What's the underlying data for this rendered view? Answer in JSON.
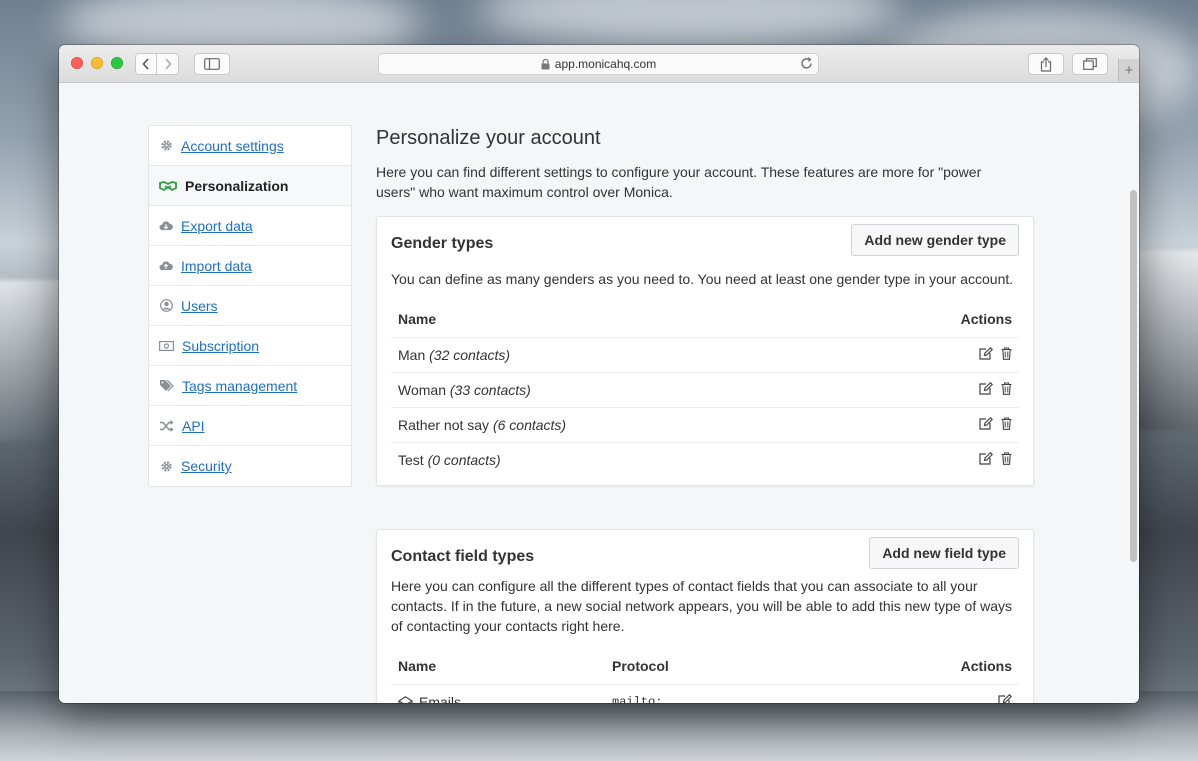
{
  "browser": {
    "url": "app.monicahq.com"
  },
  "sidebar": {
    "items": [
      {
        "label": "Account settings",
        "icon": "gear-icon",
        "active": false
      },
      {
        "label": "Personalization",
        "icon": "handshake-icon",
        "active": true
      },
      {
        "label": "Export data",
        "icon": "cloud-download-icon",
        "active": false
      },
      {
        "label": "Import data",
        "icon": "cloud-upload-icon",
        "active": false
      },
      {
        "label": "Users",
        "icon": "user-circle-icon",
        "active": false
      },
      {
        "label": "Subscription",
        "icon": "money-icon",
        "active": false
      },
      {
        "label": "Tags management",
        "icon": "tags-icon",
        "active": false
      },
      {
        "label": "API",
        "icon": "random-icon",
        "active": false
      },
      {
        "label": "Security",
        "icon": "gear-icon",
        "active": false
      }
    ]
  },
  "main": {
    "title": "Personalize your account",
    "intro": "Here you can find different settings to configure your account. These features are more for \"power users\" who want maximum control over Monica."
  },
  "gender_types": {
    "title": "Gender types",
    "add_button": "Add new gender type",
    "description": "You can define as many genders as you need to. You need at least one gender type in your account.",
    "columns": {
      "name": "Name",
      "actions": "Actions"
    },
    "rows": [
      {
        "name": "Man",
        "count": "(32 contacts)"
      },
      {
        "name": "Woman",
        "count": "(33 contacts)"
      },
      {
        "name": "Rather not say",
        "count": "(6 contacts)"
      },
      {
        "name": "Test",
        "count": "(0 contacts)"
      }
    ]
  },
  "contact_field_types": {
    "title": "Contact field types",
    "add_button": "Add new field type",
    "description": "Here you can configure all the different types of contact fields that you can associate to all your contacts. If in the future, a new social network appears, you will be able to add this new type of ways of contacting your contacts right here.",
    "columns": {
      "name": "Name",
      "protocol": "Protocol",
      "actions": "Actions"
    },
    "rows": [
      {
        "name": "Emails",
        "protocol": "mailto:",
        "icon": "envelope-open-icon"
      }
    ]
  },
  "colors": {
    "link": "#1f6fc9",
    "active_icon": "#2e9b3e"
  }
}
